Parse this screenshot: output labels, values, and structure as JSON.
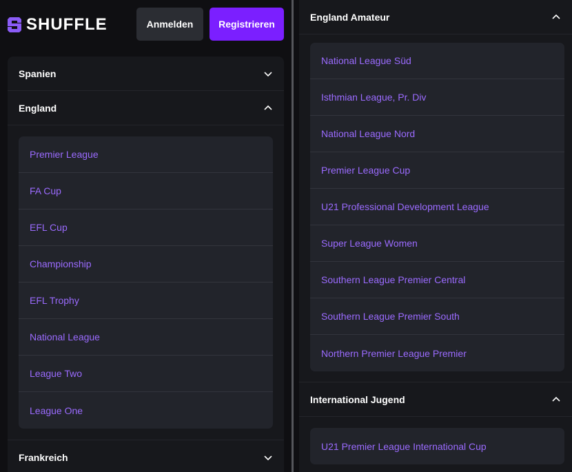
{
  "header": {
    "brand": "SHUFFLE",
    "login_label": "Anmelden",
    "register_label": "Registrieren"
  },
  "left": {
    "sections": [
      {
        "title": "Spanien",
        "expanded": false
      },
      {
        "title": "England",
        "expanded": true
      },
      {
        "title": "Frankreich",
        "expanded": false
      }
    ],
    "england_leagues": [
      "Premier League",
      "FA Cup",
      "EFL Cup",
      "Championship",
      "EFL Trophy",
      "National League",
      "League Two",
      "League One"
    ]
  },
  "right": {
    "amateur": {
      "title": "England Amateur",
      "expanded": true,
      "leagues": [
        "National League Süd",
        "Isthmian League, Pr. Div",
        "National League Nord",
        "Premier League Cup",
        "U21 Professional Development League",
        "Super League Women",
        "Southern League Premier Central",
        "Southern League Premier South",
        "Northern Premier League Premier"
      ]
    },
    "jugend": {
      "title": "International Jugend",
      "expanded": true,
      "leagues": [
        "U21 Premier League International Cup"
      ]
    }
  },
  "colors": {
    "background": "#0f0f12",
    "card": "#17181c",
    "list_bg": "#22242b",
    "link": "#9b6bff",
    "accent": "#7b1fff"
  },
  "icons": {
    "logo": "shuffle-logo-icon",
    "collapsed": "chevron-down-icon",
    "expanded": "chevron-up-icon"
  }
}
